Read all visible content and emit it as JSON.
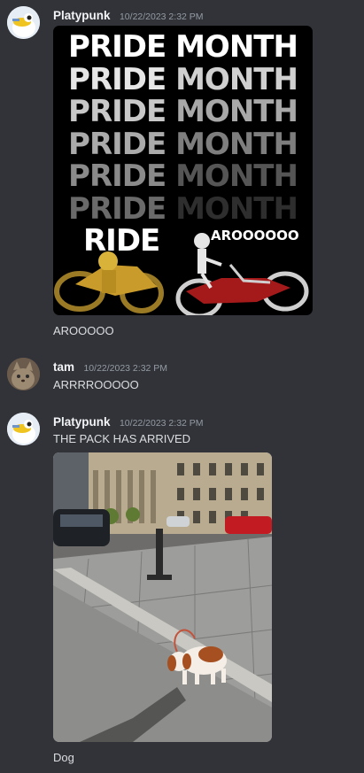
{
  "messages": [
    {
      "username": "Platypunk",
      "timestamp": "10/22/2023 2:32 PM",
      "avatar_icon": "platypus-avatar-icon",
      "attachment": {
        "kind": "pride-month-image",
        "rows": [
          {
            "a": "PRIDE",
            "b": "MONTH",
            "color_a": "#ffffff",
            "color_b": "#ffffff"
          },
          {
            "a": "PRIDE",
            "b": "MONTH",
            "color_a": "#e6e6e6",
            "color_b": "#d0d0d0"
          },
          {
            "a": "PRIDE",
            "b": "MONTH",
            "color_a": "#c8c8c8",
            "color_b": "#a8a8a8"
          },
          {
            "a": "PRIDE",
            "b": "MONTH",
            "color_a": "#aaaaaa",
            "color_b": "#7e7e7e"
          },
          {
            "a": "PRIDE",
            "b": "MONTH",
            "color_a": "#8a8a8a",
            "color_b": "#555555"
          },
          {
            "a": "PRIDE",
            "b": "MONTH",
            "color_a": "#6a6a6a",
            "color_b": "#2e2e2e"
          },
          {
            "a": "RIDE",
            "b": "",
            "color_a": "#ffffff",
            "color_b": "#000000"
          }
        ],
        "badge": "AROOOOOO"
      },
      "text": "AROOOOO"
    },
    {
      "username": "tam",
      "timestamp": "10/22/2023 2:32 PM",
      "avatar_icon": "cat-avatar-icon",
      "text": "ARRRROOOOO"
    },
    {
      "username": "Platypunk",
      "timestamp": "10/22/2023 2:32 PM",
      "avatar_icon": "platypus-avatar-icon",
      "text": "THE PACK HAS ARRIVED",
      "attachment": {
        "kind": "dog-photo"
      },
      "caption": "Dog"
    }
  ]
}
